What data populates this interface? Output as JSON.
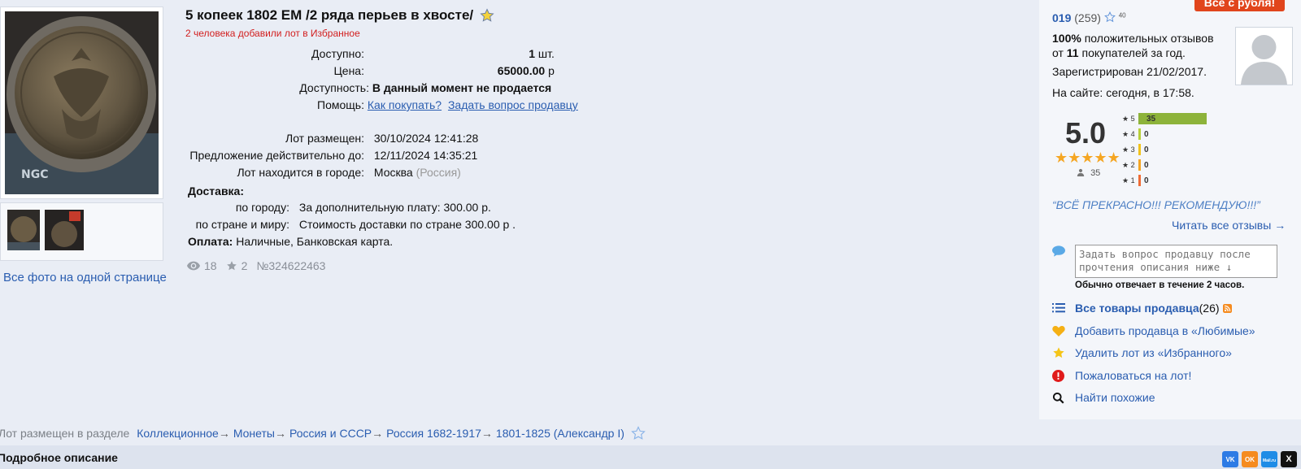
{
  "lot": {
    "title": "5 копеек 1802 ЕМ /2 ряда перьев в хвосте/",
    "favorites_note": "2 человека добавили лот в Избранное",
    "available_label": "Доступно:",
    "available_qty": "1",
    "available_unit": " шт.",
    "price_label": "Цена:",
    "price_value": "65000.00",
    "price_currency": " р",
    "availability_label": "Доступность:",
    "availability_value": "В данный момент не продается",
    "help_label": "Помощь:",
    "help_link_how": "Как покупать?",
    "help_link_ask": "Задать вопрос продавцу",
    "posted_label": "Лот размещен:",
    "posted_value": "30/10/2024 12:41:28",
    "valid_label": "Предложение действительно до:",
    "valid_value": "12/11/2024 14:35:21",
    "city_label": "Лот находится в городе:",
    "city_value": "Москва",
    "city_country": "(Россия)",
    "delivery_label": "Доставка:",
    "delivery_city_label": "по городу:",
    "delivery_city_value": "За дополнительную плату: 300.00 р.",
    "delivery_country_label": "по стране и миру:",
    "delivery_country_value": "Стоимость доставки по стране 300.00 р .",
    "payment_label": "Оплата:",
    "payment_value": "Наличные, Банковская карта.",
    "views": "18",
    "stars": "2",
    "lot_number": "№324622463"
  },
  "gallery": {
    "all_photos_link": "Все фото на одной странице"
  },
  "seller": {
    "sale_tag": "Все с рубля!",
    "name": "019",
    "count": "(259)",
    "star_count": "40",
    "positive_pct": "100%",
    "positive_text": " положительных отзывов",
    "from_text": "от ",
    "buyers_count": "11",
    "buyers_text": " покупателей за год.",
    "registered": "Зарегистрирован 21/02/2017.",
    "online": "На сайте: сегодня, в 17:58.",
    "rating": "5.0",
    "reviews_count": "35",
    "rating_rows": [
      {
        "star": "5",
        "value": "35",
        "fill": 1.0,
        "color": "#8db33a"
      },
      {
        "star": "4",
        "value": "0",
        "fill": 0,
        "color": "#b7cf3a"
      },
      {
        "star": "3",
        "value": "0",
        "fill": 0,
        "color": "#f2c31b"
      },
      {
        "star": "2",
        "value": "0",
        "fill": 0,
        "color": "#f5a623"
      },
      {
        "star": "1",
        "value": "0",
        "fill": 0,
        "color": "#ef6b35"
      }
    ],
    "quote": "“ВСЁ ПРЕКРАСНО!!! РЕКОМЕНДУЮ!!!”",
    "read_reviews": "Читать все отзывы →",
    "ask_placeholder": "Задать вопрос продавцу после прочтения описания ниже ↓",
    "reply_time": "Обычно отвечает в течение 2 часов.",
    "all_items_label": "Все товары продавца",
    "all_items_count": " (26)",
    "add_favorite": "Добавить продавца в «Любимые»",
    "remove_lot": "Удалить лот из «Избранного»",
    "complain": "Пожаловаться на лот!",
    "find_similar": "Найти похожие"
  },
  "breadcrumb": {
    "label": "Лот размещен в разделе",
    "items": [
      "Коллекционное",
      "Монеты",
      "Россия и СССР",
      "Россия 1682-1917",
      "1801-1825 (Александр I)"
    ]
  },
  "description": {
    "title": "Подробное описание"
  },
  "social": [
    "VK",
    "OK",
    "Mail.ru",
    "X"
  ]
}
